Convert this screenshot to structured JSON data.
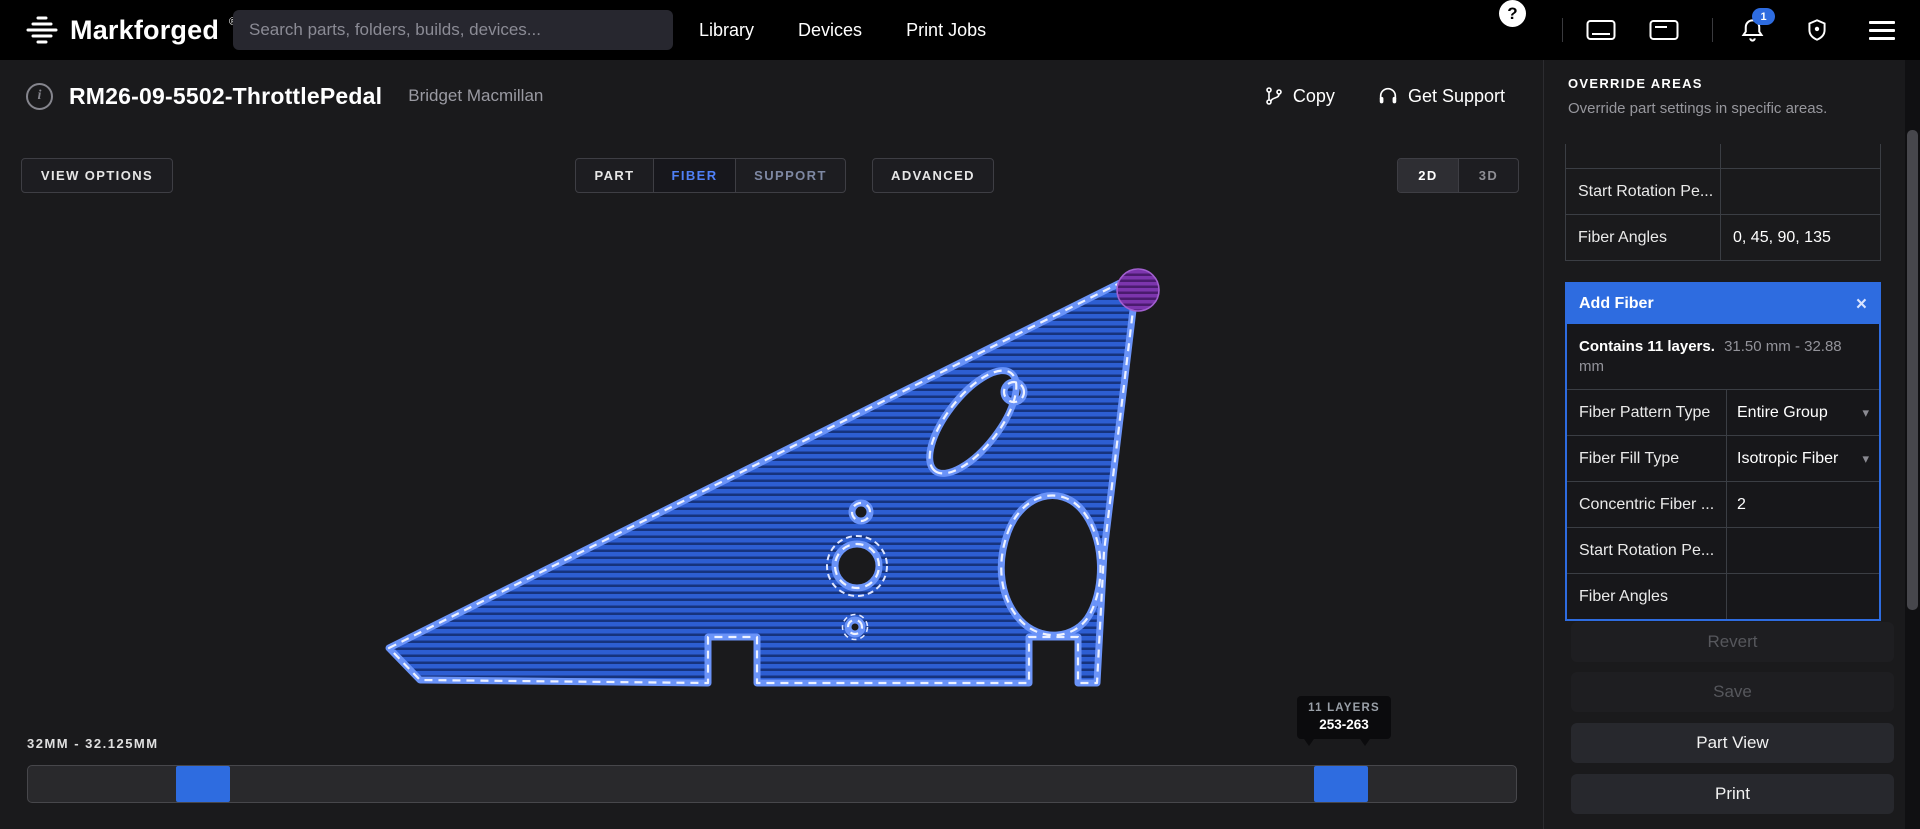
{
  "nav": {
    "brand": "Markforged",
    "brand_mark": "®",
    "search_placeholder": "Search parts, folders, builds, devices...",
    "links": [
      "Library",
      "Devices",
      "Print Jobs"
    ],
    "help_glyph": "?",
    "notification_badge": "1"
  },
  "header": {
    "title": "RM26-09-5502-ThrottlePedal",
    "owner": "Bridget Macmillan",
    "info_glyph": "i",
    "copy_label": "Copy",
    "support_label": "Get Support"
  },
  "toolbar": {
    "view_options": "VIEW OPTIONS",
    "tabs": [
      "PART",
      "FIBER",
      "SUPPORT"
    ],
    "advanced": "ADVANCED",
    "dims": [
      "2D",
      "3D"
    ]
  },
  "viewer": {
    "range_label": "32MM - 32.125MM",
    "tooltip_label": "11 LAYERS",
    "tooltip_range": "253-263"
  },
  "sidebar": {
    "heading": "OVERRIDE AREAS",
    "description": "Override part settings in specific areas.",
    "group_rows": [
      {
        "label": "Start Rotation Pe...",
        "value": ""
      },
      {
        "label": "Fiber Angles",
        "value": "0, 45, 90, 135"
      }
    ],
    "add_fiber": {
      "title": "Add Fiber",
      "close_glyph": "×",
      "caret_glyph": "▾",
      "summary_bold": "Contains 11 layers.",
      "summary_detail": "31.50 mm - 32.88 mm",
      "rows": [
        {
          "label": "Fiber Pattern Type",
          "value": "Entire Group"
        },
        {
          "label": "Fiber Fill Type",
          "value": "Isotropic Fiber"
        },
        {
          "label": "Concentric Fiber ...",
          "value": "2"
        },
        {
          "label": "Start Rotation Pe...",
          "value": ""
        },
        {
          "label": "Fiber Angles",
          "value": ""
        }
      ]
    },
    "buttons": {
      "revert": "Revert",
      "save": "Save",
      "part_view": "Part View",
      "print": "Print"
    }
  },
  "colors": {
    "accent": "#2e6ce0",
    "part_blue": "#2d5ed2",
    "part_purple": "#7c35ad",
    "background": "#1a1a1c"
  }
}
